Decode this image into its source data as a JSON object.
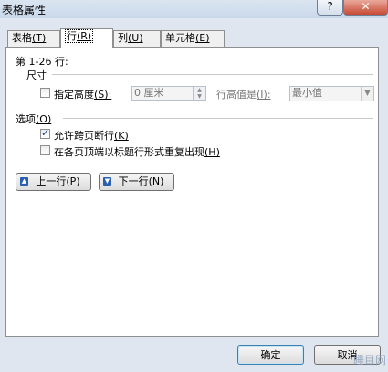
{
  "window": {
    "title": "表格属性",
    "help_label": "?",
    "close_label": "✕"
  },
  "tabs": [
    {
      "label": "表格",
      "key": "(T)"
    },
    {
      "label": "行",
      "key": "(R)"
    },
    {
      "label": "列",
      "key": "(U)"
    },
    {
      "label": "单元格",
      "key": "(E)"
    }
  ],
  "row_panel": {
    "heading": "第 1-26 行:",
    "size_section": "尺寸",
    "specify_height": {
      "label": "指定高度",
      "key": "(S):",
      "checked": false
    },
    "height_value": "0 厘米",
    "row_height_is": {
      "label": "行高值是",
      "key": "(I):"
    },
    "row_height_mode": "最小值",
    "options_section": "选项",
    "options_key": "(O)",
    "allow_break": {
      "label": "允许跨页断行",
      "key": "(K)",
      "checked": true
    },
    "repeat_header": {
      "label": "在各页顶端以标题行形式重复出现",
      "key": "(H)",
      "checked": false
    },
    "prev_row": {
      "label": "上一行",
      "key": "(P)"
    },
    "next_row": {
      "label": "下一行",
      "key": "(N)"
    }
  },
  "footer": {
    "ok_label": "确定",
    "cancel_label": "取消"
  },
  "watermark": "睡目网"
}
